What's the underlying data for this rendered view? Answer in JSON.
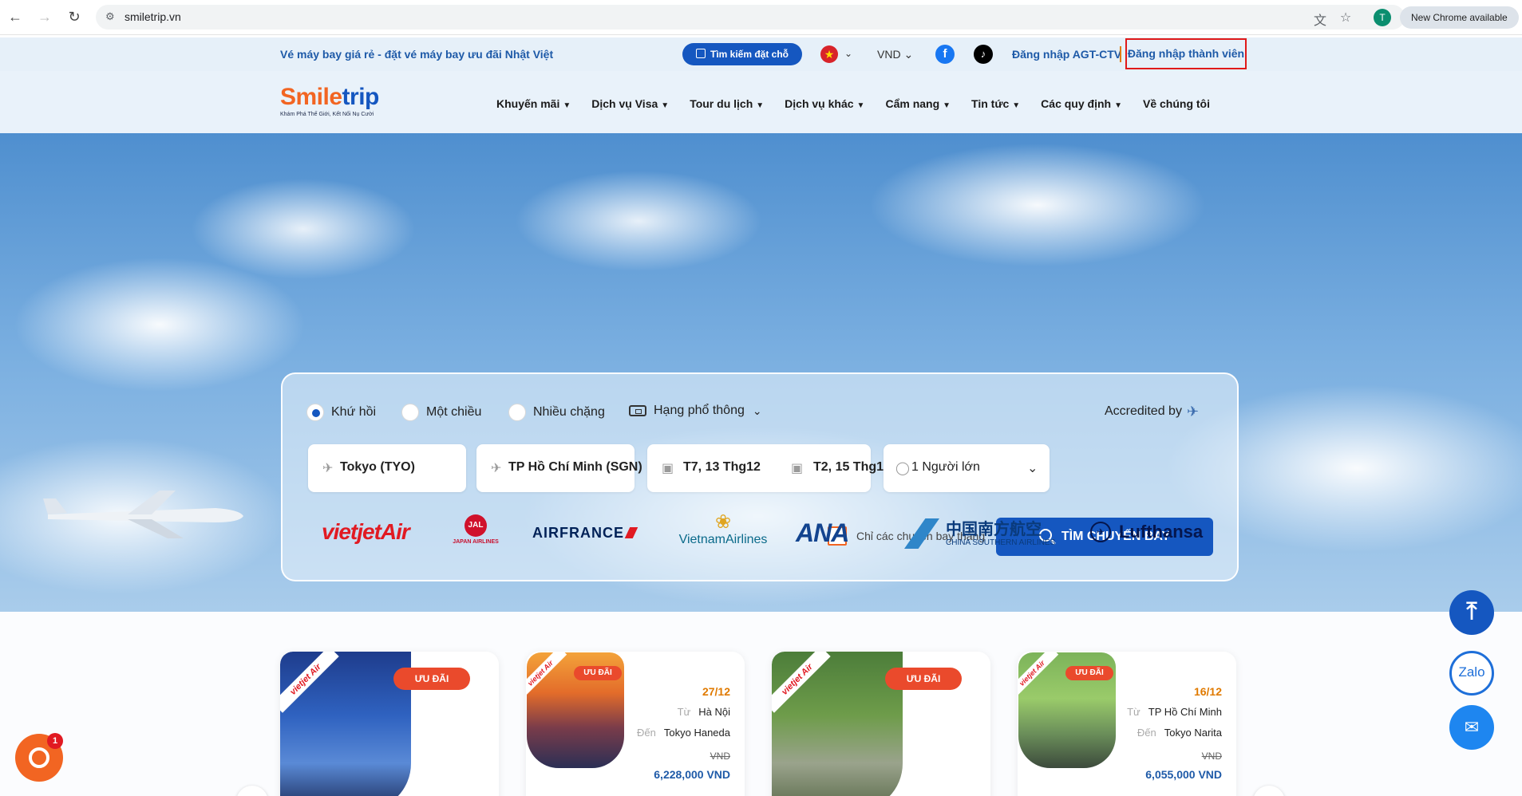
{
  "browser": {
    "url": "smiletrip.vn",
    "profile_initial": "T",
    "chrome_update": "New Chrome available"
  },
  "topbar": {
    "tagline": "Vé máy bay giá rẻ - đặt vé máy bay ưu đãi Nhật Việt",
    "search_booking": "Tìm kiếm đặt chỗ",
    "currency": "VND",
    "login_agent": "Đăng nhập AGT-CTV",
    "login_member": "Đăng nhập thành viên"
  },
  "header": {
    "logo_smile": "Smile",
    "logo_trip": "trip",
    "logo_tagline": "Khám Phá Thế Giới, Kết Nối Nụ Cười",
    "menu": [
      "Khuyến mãi",
      "Dịch vụ Visa",
      "Tour du lịch",
      "Dịch vụ khác",
      "Cẩm nang",
      "Tin tức",
      "Các quy định",
      "Về chúng tôi"
    ]
  },
  "search": {
    "trip_types": [
      "Khứ hồi",
      "Một chiều",
      "Nhiều chặng"
    ],
    "selected_trip_type": "Khứ hồi",
    "cabin_class": "Hạng phổ thông",
    "accredited_by": "Accredited by",
    "from": "Tokyo (TYO)",
    "to": "TP Hồ Chí Minh (SGN)",
    "depart_date": "T7, 13 Thg12",
    "return_date": "T2, 15 Thg12",
    "passengers": "1 Người lớn",
    "direct_only_label": "Chỉ các chuyến bay thẳng",
    "search_button": "TÌM CHUYẾN BAY"
  },
  "airlines": {
    "vietjet": "vietjetAir",
    "jal": "JAPAN AIRLINES",
    "jal_mark": "JAL",
    "airfrance": "AIRFRANCE",
    "vna": "VietnamAirlines",
    "ana": "ANA",
    "csa_cn": "中国南方航空",
    "csa_en": "CHINA SOUTHERN AIRLINES",
    "lufthansa": "Lufthansa"
  },
  "deals": {
    "badge": "ƯU ĐÃI",
    "ribbon": "vietjet Air",
    "from_label": "Từ",
    "to_label": "Đến",
    "cards": [
      {
        "date": "27/12",
        "from": "Hà Nội",
        "to": "Tokyo Haneda",
        "old_price": "VND",
        "price": "6,228,000 VND"
      },
      {
        "date": "16/12",
        "from": "TP Hồ Chí Minh",
        "to": "Tokyo Narita",
        "old_price": "VND",
        "price": "6,055,000 VND"
      }
    ]
  },
  "floating": {
    "zalo": "Zalo",
    "chat_badge": "1"
  },
  "colors": {
    "brand_blue": "#1557c0",
    "brand_orange": "#f26522",
    "highlight_red": "#e01919"
  }
}
